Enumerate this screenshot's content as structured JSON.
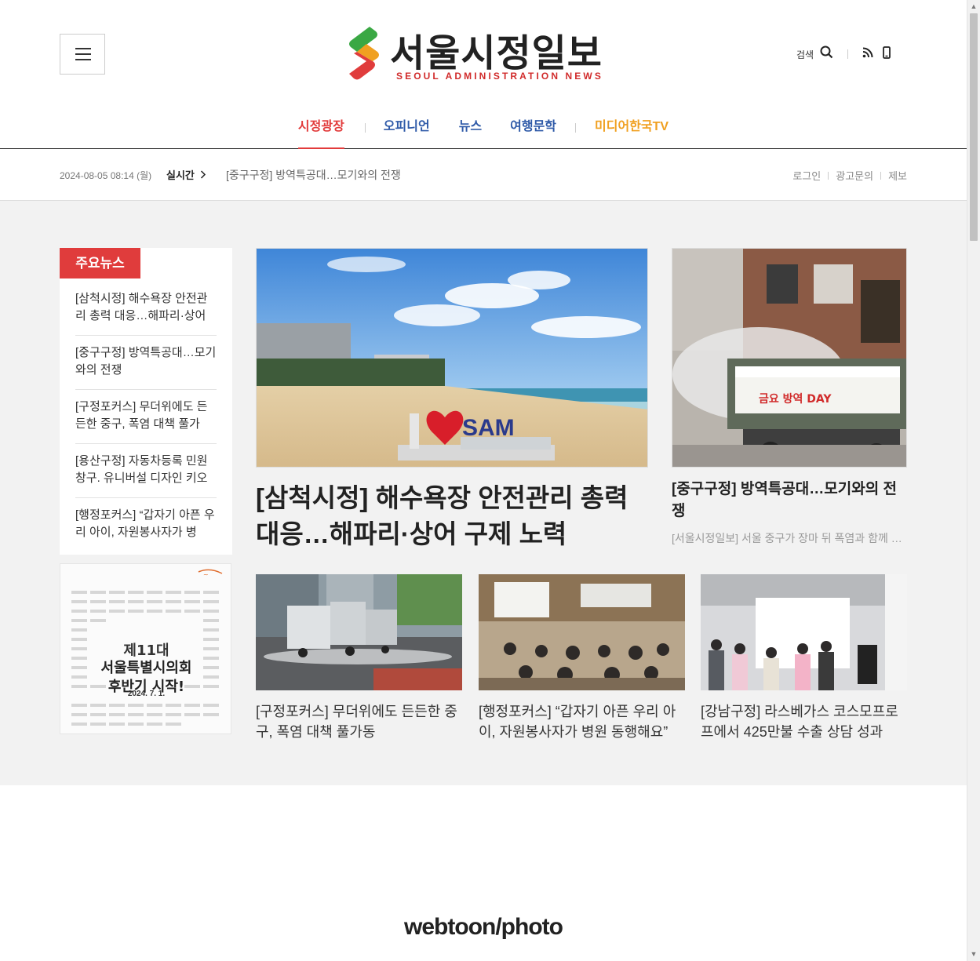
{
  "header": {
    "menu_label": "menu",
    "logo_title": "서울시정일보",
    "logo_subtitle": "SEOUL ADMINISTRATION NEWS",
    "search_label": "검색"
  },
  "gnb": [
    {
      "label": "시정광장",
      "color": "#e23b3b"
    },
    {
      "label": "오피니언",
      "color": "#2f5aa8"
    },
    {
      "label": "뉴스",
      "color": "#2f5aa8"
    },
    {
      "label": "여행문학",
      "color": "#2f5aa8"
    },
    {
      "label": "미디어한국TV",
      "color": "#f0a020"
    }
  ],
  "infobar": {
    "date": "2024-08-05 08:14 (월)",
    "live_label": "실시간",
    "ticker": "[중구구정] 방역특공대…모기와의 전쟁",
    "links": [
      "로그인",
      "광고문의",
      "제보"
    ]
  },
  "side": {
    "badge": "주요뉴스",
    "items": [
      "[삼척시정] 해수욕장 안전관리 총력 대응…해파리·상어",
      "[중구구정] 방역특공대…모기와의 전쟁",
      "[구정포커스] 무더위에도 든든한 중구, 폭염 대책 풀가",
      "[용산구정] 자동차등록 민원창구. 유니버설 디자인 키오",
      "[행정포커스] “갑자기 아픈 우리 아이, 자원봉사자가 병"
    ]
  },
  "banner": {
    "line1": "제11대",
    "line2": "서울특별시의회",
    "line3": "후반기 시작!",
    "date": "2024. 7. 1."
  },
  "hero": {
    "title": "[삼척시정] 해수욕장 안전관리 총력 대응…해파리·상어 구제 노력",
    "sign": "SAM"
  },
  "sub": {
    "title": "[중구구정] 방역특공대…모기와의 전쟁",
    "desc": "[서울시정일보] 서울 중구가 장마 뒤 폭염과 함께 모기"
  },
  "cards": [
    {
      "title": "[구정포커스] 무더위에도 든든한 중구, 폭염 대책 풀가동"
    },
    {
      "title": "[행정포커스] “갑자기 아픈 우리 아이, 자원봉사자가 병원 동행해요”"
    },
    {
      "title": "[강남구정] 라스베가스 코스모프로프에서 425만불 수출 상담 성과"
    }
  ],
  "section_title": "webtoon/photo",
  "colors": {
    "accent_red": "#e03c3c",
    "nav_blue": "#2f5aa8",
    "nav_orange": "#f0a020",
    "bg_grey": "#f2f2f2"
  }
}
